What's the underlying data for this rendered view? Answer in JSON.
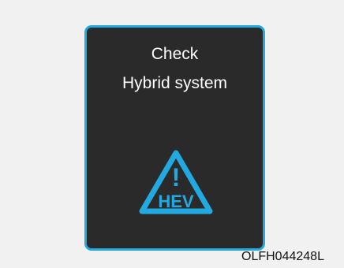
{
  "display": {
    "line1": "Check",
    "line2": "Hybrid system",
    "icon": {
      "name": "hev-warning-triangle-icon",
      "exclamation": "!",
      "label": "HEV",
      "color": "#22a9df"
    }
  },
  "caption": "OLFH044248L",
  "colors": {
    "background": "#f1f1f1",
    "panel": "#2a2a2a",
    "panel_border": "#22a9df",
    "text": "#ffffff",
    "caption": "#111111"
  }
}
